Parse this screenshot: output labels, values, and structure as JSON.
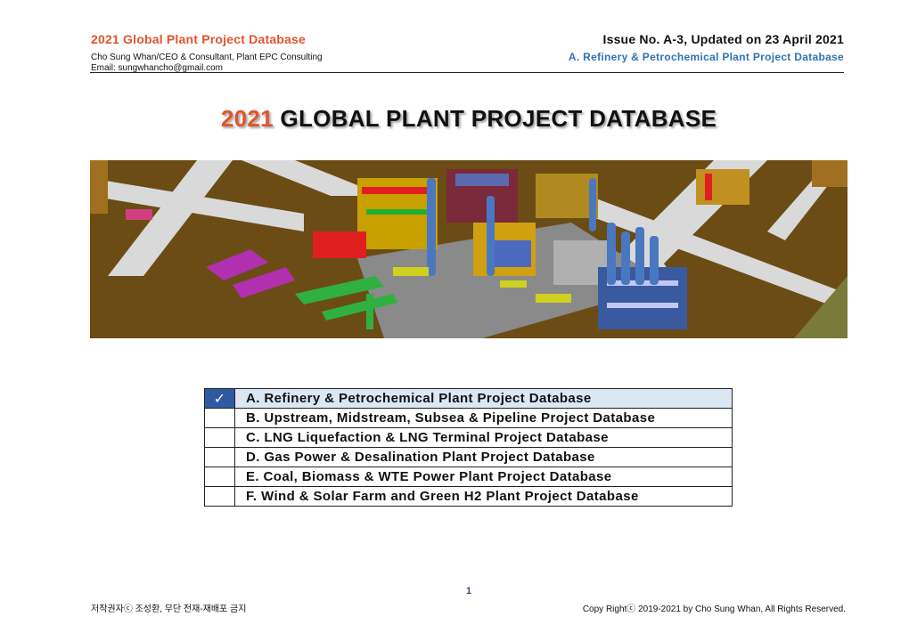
{
  "header": {
    "title": "2021 Global Plant Project Database",
    "author": "Cho Sung Whan/CEO & Consultant, Plant EPC Consulting",
    "email": "Email: sungwhancho@gmail.com",
    "issue": "Issue No. A-3, Updated on 23 April 2021",
    "database": "A. Refinery & Petrochemical Plant Project Database"
  },
  "main_title": {
    "year": "2021",
    "rest": " GLOBAL PLANT PROJECT DATABASE"
  },
  "toc": {
    "check_glyph": "✓",
    "items": [
      {
        "label": "A.  Refinery & Petrochemical Plant Project Database"
      },
      {
        "label": "B.  Upstream, Midstream, Subsea & Pipeline Project Database"
      },
      {
        "label": "C.  LNG Liquefaction & LNG Terminal Project Database"
      },
      {
        "label": "D.  Gas Power & Desalination Plant Project Database"
      },
      {
        "label": "E.  Coal, Biomass & WTE Power Plant Project Database"
      },
      {
        "label": "F.  Wind & Solar Farm and Green H2 Plant Project Database"
      }
    ]
  },
  "footer": {
    "page_number": "1",
    "left": "저작권자ⓒ 조성환, 무단 전재-재배포 금지",
    "right": "Copy Rightⓒ 2019-2021 by Cho Sung Whan, All Rights Reserved."
  },
  "colors": {
    "accent": "#e0552b",
    "blue": "#2e74b5",
    "check_bg": "#2f5aa3",
    "selected_row": "#dce7f4"
  }
}
